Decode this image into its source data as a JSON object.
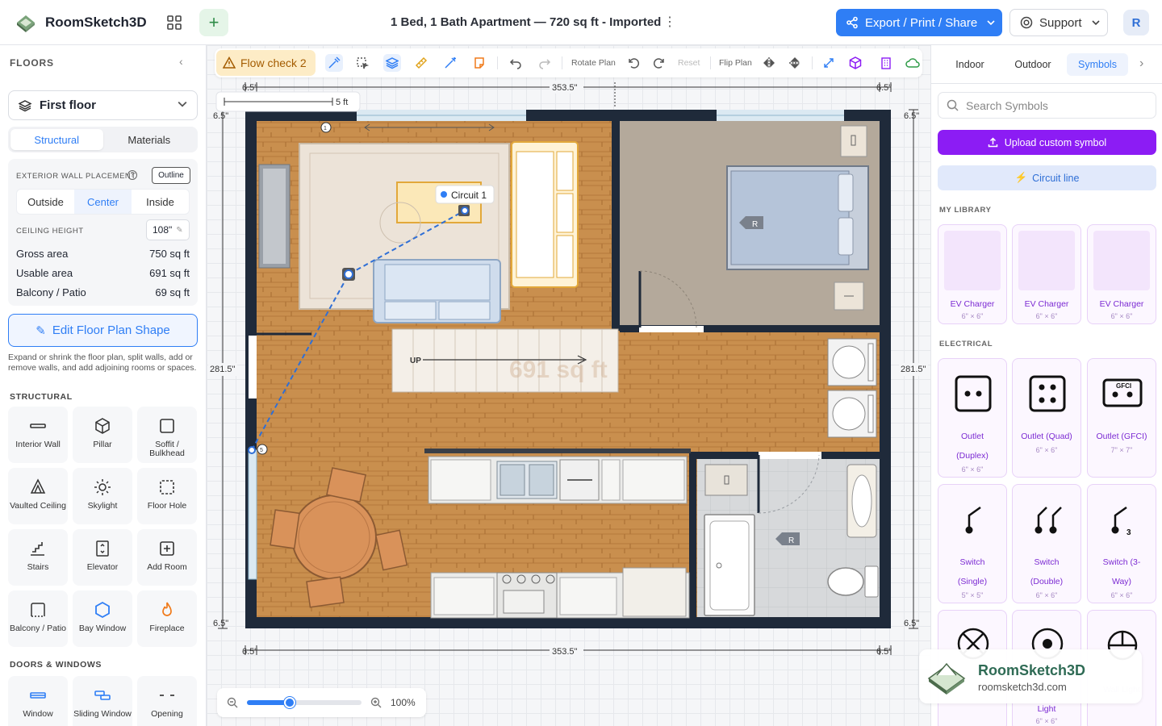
{
  "app": {
    "name": "RoomSketch3D",
    "doc_title": "1 Bed, 1 Bath Apartment — 720 sq ft - Imported",
    "export_label": "Export / Print / Share",
    "support_label": "Support",
    "avatar_initial": "R",
    "accent": "#2f7ef5"
  },
  "sidebar": {
    "heading": "FLOORS",
    "floor": "First floor",
    "tabs": [
      "Structural",
      "Materials"
    ],
    "wall_placement_label": "EXTERIOR WALL PLACEMENT",
    "outline_label": "Outline",
    "placements": [
      "Outside",
      "Center",
      "Inside"
    ],
    "ceiling_label": "CEILING HEIGHT",
    "ceiling_value": "108\"",
    "stats": [
      {
        "k": "Gross area",
        "v": "750 sq ft"
      },
      {
        "k": "Usable area",
        "v": "691 sq ft"
      },
      {
        "k": "Balcony / Patio",
        "v": "69 sq ft"
      }
    ],
    "edit_shape_label": "Edit Floor Plan Shape",
    "hint": "Expand or shrink the floor plan, split walls, add or remove walls, and add adjoining rooms or spaces.",
    "structural_title": "STRUCTURAL",
    "tools": [
      "Interior Wall",
      "Pillar",
      "Soffit / Bulkhead",
      "Vaulted Ceiling",
      "Skylight",
      "Floor Hole",
      "Stairs",
      "Elevator",
      "Add Room",
      "Balcony / Patio",
      "Bay Window",
      "Fireplace"
    ],
    "doors_title": "DOORS & WINDOWS",
    "door_tools": [
      "Window",
      "Sliding Window",
      "Opening"
    ]
  },
  "toolbar": {
    "flow_check": "Flow check 2",
    "rotate": "Rotate Plan",
    "reset": "Reset",
    "flip": "Flip Plan"
  },
  "plan": {
    "scale": "5 ft",
    "top_mid": "353.5\"",
    "bot_mid": "353.5\"",
    "edge": "6.5\"",
    "height": "281.5\"",
    "circuit": "Circuit 1",
    "stairs": "UP",
    "watermark_area": "691 sq ft",
    "label_r": "R",
    "circuit_num_a": "1",
    "circuit_num_b": "5"
  },
  "zoom": {
    "value": "100%",
    "fraction": 0.37
  },
  "right": {
    "tabs": [
      "Indoor",
      "Outdoor",
      "Symbols"
    ],
    "search_placeholder": "Search Symbols",
    "upload_label": "Upload custom symbol",
    "circuit_label": "Circuit line",
    "library_title": "MY LIBRARY",
    "library": [
      {
        "n": "EV Charger",
        "d": "6\" × 6\""
      },
      {
        "n": "EV Charger",
        "d": "6\" × 6\""
      },
      {
        "n": "EV Charger",
        "d": "6\" × 6\""
      }
    ],
    "electrical_title": "ELECTRICAL",
    "electrical": [
      {
        "n1": "Outlet",
        "n2": "(Duplex)",
        "d": "6\" × 6\""
      },
      {
        "n1": "Outlet (Quad)",
        "n2": "",
        "d": "6\" × 6\""
      },
      {
        "n1": "Outlet (GFCI)",
        "n2": "",
        "d": "7\" × 7\""
      },
      {
        "n1": "Switch",
        "n2": "(Single)",
        "d": "5\" × 5\""
      },
      {
        "n1": "Switch",
        "n2": "(Double)",
        "d": "6\" × 6\""
      },
      {
        "n1": "Switch (3-",
        "n2": "Way)",
        "d": "6\" × 6\""
      }
    ],
    "bottom_cards": [
      {
        "n": "Light",
        "d": "6\" × 6\""
      },
      {
        "n": "Wall Light",
        "d": ""
      }
    ],
    "gfci": "GFCI",
    "three": "3"
  },
  "watermark": {
    "name": "RoomSketch3D",
    "url": "roomsketch3d.com"
  }
}
